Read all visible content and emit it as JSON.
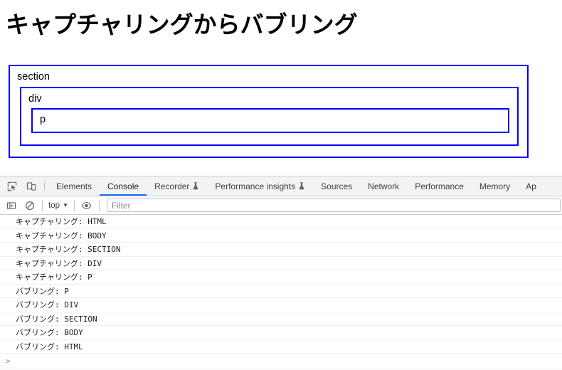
{
  "page": {
    "title": "キャプチャリングからバブリング",
    "boxes": {
      "section_label": "section",
      "div_label": "div",
      "p_label": "p"
    },
    "border_color": "#0000ff"
  },
  "devtools": {
    "toolbar_icons": [
      {
        "name": "inspect-element-icon",
        "title": "Inspect element"
      },
      {
        "name": "device-toolbar-icon",
        "title": "Toggle device toolbar"
      }
    ],
    "tabs": [
      {
        "label": "Elements",
        "active": false,
        "flask": false
      },
      {
        "label": "Console",
        "active": true,
        "flask": false
      },
      {
        "label": "Recorder",
        "active": false,
        "flask": true
      },
      {
        "label": "Performance insights",
        "active": false,
        "flask": true
      },
      {
        "label": "Sources",
        "active": false,
        "flask": false
      },
      {
        "label": "Network",
        "active": false,
        "flask": false
      },
      {
        "label": "Performance",
        "active": false,
        "flask": false
      },
      {
        "label": "Memory",
        "active": false,
        "flask": false
      },
      {
        "label": "Ap",
        "active": false,
        "flask": false
      }
    ],
    "active_tab_color": "#1a73e8",
    "console_toolbar": {
      "sidebar_toggle_title": "Show console sidebar",
      "clear_console_title": "Clear console",
      "context": "top",
      "context_caret": "▼",
      "eye_title": "Create live expression",
      "filter_placeholder": "Filter",
      "filter_value": ""
    },
    "console_messages": [
      "キャプチャリング: HTML",
      "キャプチャリング: BODY",
      "キャプチャリング: SECTION",
      "キャプチャリング: DIV",
      "キャプチャリング: P",
      "バブリング: P",
      "バブリング: DIV",
      "バブリング: SECTION",
      "バブリング: BODY",
      "バブリング: HTML"
    ],
    "prompt": {
      "chevron": ">",
      "value": ""
    }
  }
}
